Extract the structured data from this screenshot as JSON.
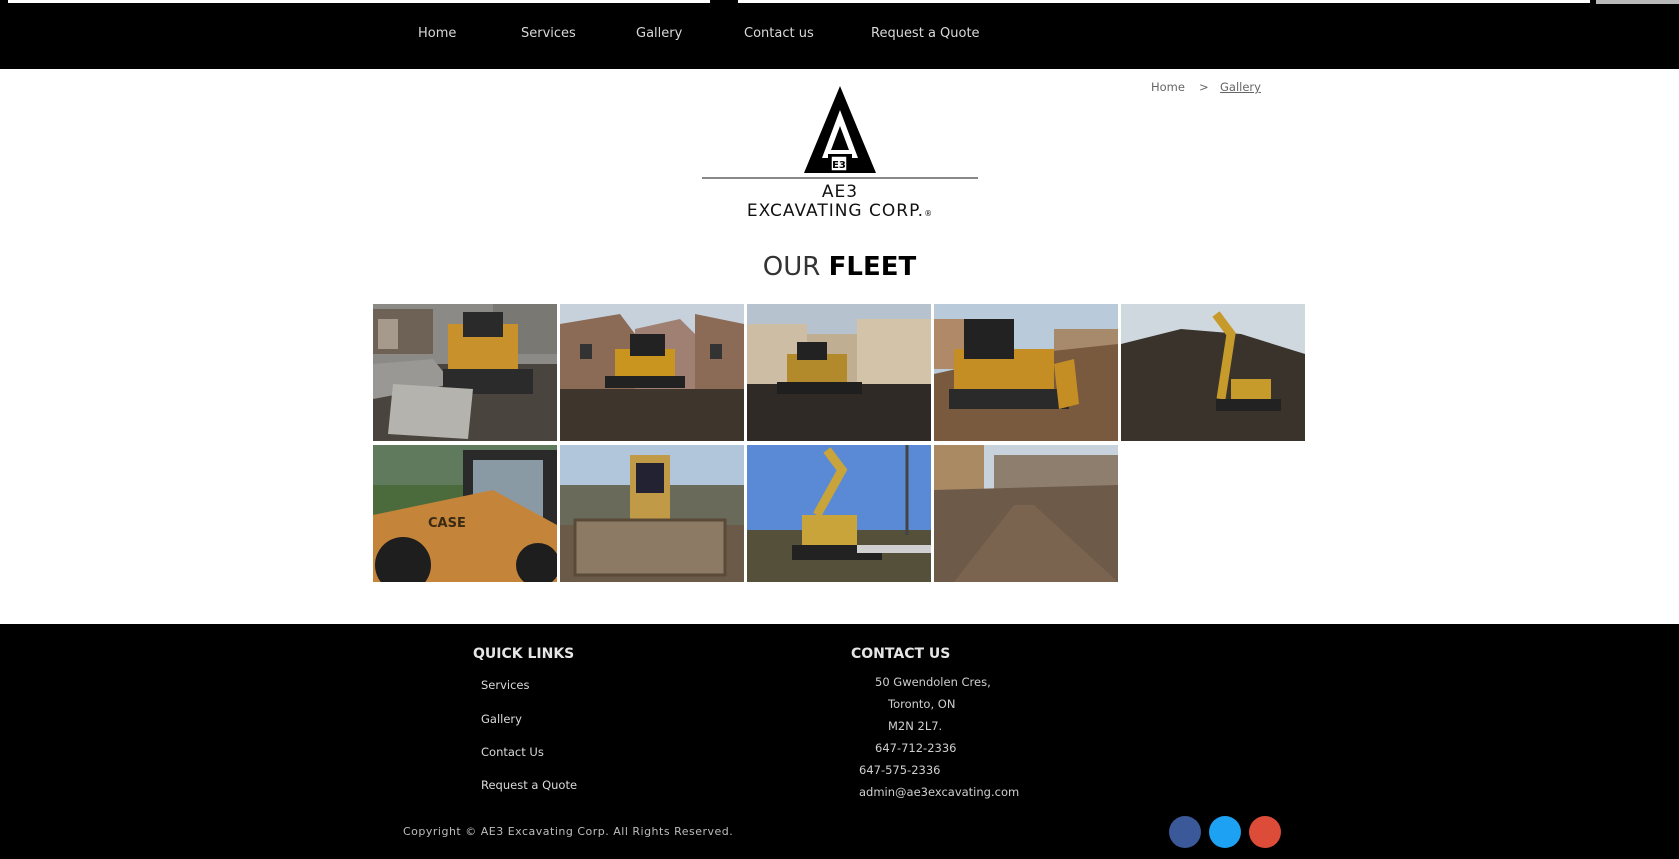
{
  "nav": {
    "items": [
      "Home",
      "Services",
      "Gallery",
      "Contact us",
      "Request a Quote"
    ]
  },
  "breadcrumb": {
    "home": "Home",
    "separator": ">",
    "current": "Gallery"
  },
  "logo": {
    "line1": "AE3",
    "line2": "EXCAVATING CORP.",
    "mark": "®"
  },
  "heading": {
    "part1": "OUR",
    "part2": "FLEET"
  },
  "gallery": {
    "images": [
      "bulldozer-photo",
      "dozer-between-houses-photo",
      "dozer-construction-site-photo",
      "dozer-dirt-pile-photo",
      "excavator-photo",
      "case-backhoe-photo",
      "backhoe-blade-photo",
      "excavator-blue-sky-photo",
      "graded-lot-photo"
    ]
  },
  "footer": {
    "quick_links_title": "QUICK LINKS",
    "quick_links": [
      "Services",
      "Gallery",
      "Contact Us",
      "Request a Quote"
    ],
    "contact_title": "CONTACT US",
    "address_line1": "50 Gwendolen Cres,",
    "address_line2": "Toronto, ON",
    "address_line3": "M2N 2L7.",
    "phone1": "647-712-2336",
    "phone2": "647-575-2336",
    "email": "admin@ae3excavating.com",
    "copyright": "Copyright © AE3 Excavating Corp. All Rights Reserved.",
    "social": [
      {
        "name": "facebook-icon",
        "color": "#3b5998"
      },
      {
        "name": "twitter-icon",
        "color": "#1da1f2"
      },
      {
        "name": "google-plus-icon",
        "color": "#dd4b39"
      }
    ]
  }
}
